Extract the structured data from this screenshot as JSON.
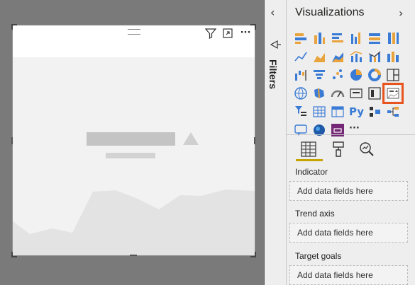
{
  "visual": {
    "toolbar": {
      "filter_icon": "filter-icon",
      "focus_icon": "focus-mode-icon",
      "more_label": "···"
    }
  },
  "filters_pane": {
    "collapse_label": "‹",
    "label": "Filters"
  },
  "visualizations_pane": {
    "title": "Visualizations",
    "expand_label": "›",
    "more_label": "···",
    "fields_tab": "fields-icon",
    "format_tab": "format-paint-icon",
    "analytics_tab": "analytics-icon",
    "wells": [
      {
        "label": "Indicator",
        "placeholder": "Add data fields here"
      },
      {
        "label": "Trend axis",
        "placeholder": "Add data fields here"
      },
      {
        "label": "Target goals",
        "placeholder": "Add data fields here"
      }
    ],
    "selected_visual": "kpi-icon",
    "colors": {
      "selected_outline": "#e8541e",
      "tab_underline": "#c8a400"
    }
  }
}
